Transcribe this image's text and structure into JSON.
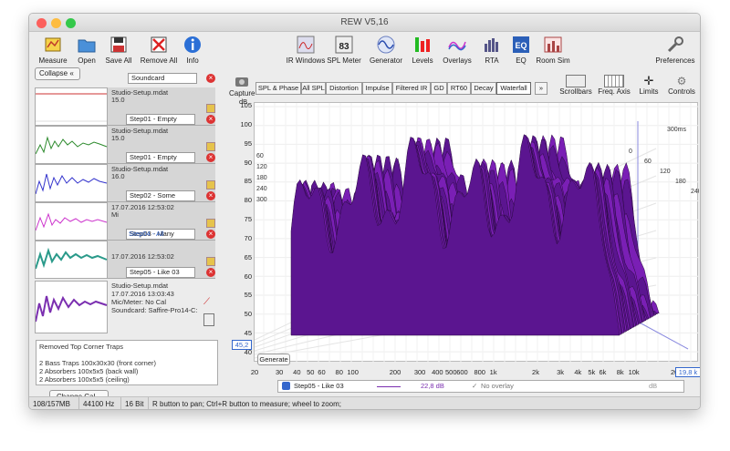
{
  "window": {
    "title": "REW V5,16"
  },
  "toolbar": {
    "left": [
      {
        "label": "Measure",
        "icon": "measure-icon"
      },
      {
        "label": "Open",
        "icon": "folder-icon"
      },
      {
        "label": "Save All",
        "icon": "save-icon"
      },
      {
        "label": "Remove All",
        "icon": "remove-icon"
      },
      {
        "label": "Info",
        "icon": "info-icon"
      }
    ],
    "center": [
      {
        "label": "IR Windows",
        "icon": "ir-windows-icon"
      },
      {
        "label": "SPL Meter",
        "icon": "spl-meter-icon",
        "value": "83"
      },
      {
        "label": "Generator",
        "icon": "generator-icon"
      },
      {
        "label": "Levels",
        "icon": "levels-icon"
      },
      {
        "label": "Overlays",
        "icon": "overlays-icon"
      },
      {
        "label": "RTA",
        "icon": "rta-icon"
      },
      {
        "label": "EQ",
        "icon": "eq-icon"
      },
      {
        "label": "Room Sim",
        "icon": "room-sim-icon"
      }
    ],
    "right": {
      "label": "Preferences",
      "icon": "wrench-icon"
    }
  },
  "sidebar": {
    "collapse_label": "Collapse",
    "soundcard_name": "Soundcard",
    "measurements": [
      {
        "name": "Step01 - Empty",
        "file": "Studio-Setup.mdat",
        "date": "15.0",
        "color": "#2c8a2c"
      },
      {
        "name": "Step02 - Some",
        "file": "Studio-Setup.mdat",
        "date": "15.0",
        "color": "#3333cc"
      },
      {
        "name": "Step03 - Many",
        "file": "Studio-Setup.mdat",
        "date": "16.0",
        "color": "#cc33cc"
      },
      {
        "name": "Step04 - All",
        "file": "17.07.2016 12:53:02",
        "date": "Mi",
        "color": "#2a9a8a"
      },
      {
        "name": "Step05 - Like 03",
        "file": "Studio-Setup.mdat",
        "date": "17.07.2016 13:03:43",
        "mic": "Mic/Meter: No Cal",
        "soundcard": "Soundcard: Saffire-Pro14-C:",
        "color": "#7b2fb0"
      }
    ],
    "notes": [
      "Removed Top Corner Traps",
      "",
      "2 Bass Traps 100x30x30 (front corner)",
      "2 Absorbers 100x5x5 (back wall)",
      "2 Absorbers 100x5x5 (ceiling)"
    ],
    "change_cal_label": "Change Cal..."
  },
  "graph": {
    "capture_label": "Capture",
    "tabs": [
      "SPL & Phase",
      "All SPL",
      "Distortion",
      "Impulse",
      "Filtered IR",
      "GD",
      "RT60",
      "Decay",
      "Waterfall"
    ],
    "active_tab": "Waterfall",
    "more_label": "»",
    "right_tools": [
      {
        "label": "Scrollbars"
      },
      {
        "label": "Freq. Axis"
      },
      {
        "label": "Limits"
      },
      {
        "label": "Controls"
      }
    ],
    "y_unit": "dB",
    "y_ticks": [
      "105",
      "100",
      "95",
      "90",
      "85",
      "80",
      "75",
      "70",
      "65",
      "60",
      "55",
      "50",
      "45",
      "40"
    ],
    "y_cursor": "45,2",
    "x_ticks": [
      "20",
      "30",
      "40",
      "50",
      "60",
      "80",
      "100",
      "200",
      "300",
      "400",
      "500",
      "600",
      "800",
      "1k",
      "2k",
      "3k",
      "4k",
      "5k",
      "6k",
      "8k",
      "10k",
      "20k"
    ],
    "x_cursor": "19,8 k",
    "time_ticks": [
      "0",
      "60",
      "120",
      "180",
      "240",
      "300"
    ],
    "time_label": "300ms",
    "generate_label": "Generate",
    "legend": {
      "name": "Step05 - Like 03",
      "value": "22,8 dB",
      "overlay": "No overlay",
      "unit": "dB"
    },
    "waterfall_color": "#7a1fb5"
  },
  "status": {
    "memory": "108/157MB",
    "rate": "44100 Hz",
    "bits": "16 Bit",
    "hint": "R button to pan; Ctrl+R button to measure; wheel to zoom;"
  }
}
